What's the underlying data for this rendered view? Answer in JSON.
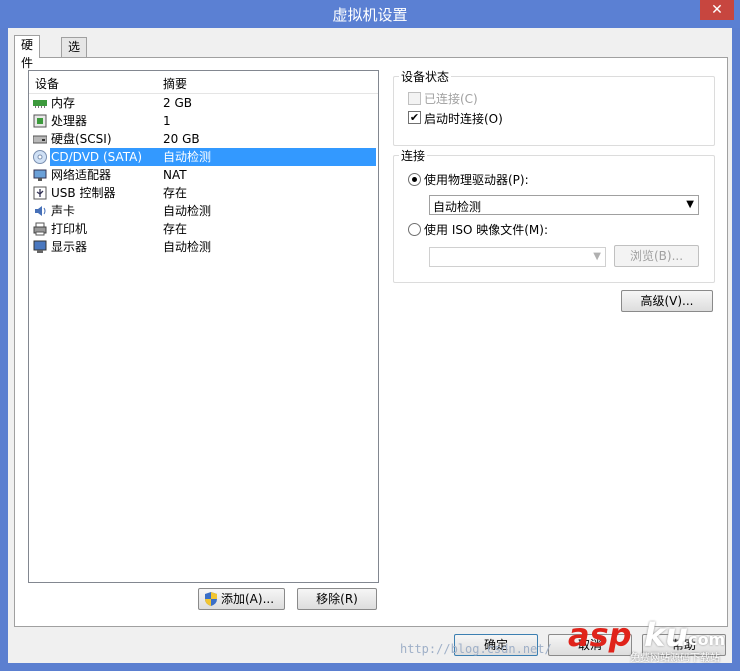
{
  "window": {
    "title": "虚拟机设置",
    "close_glyph": "✕"
  },
  "tabs": [
    {
      "label": "硬件",
      "active": true
    },
    {
      "label": "选项",
      "active": false
    }
  ],
  "device_list": {
    "columns": {
      "device": "设备",
      "summary": "摘要"
    },
    "rows": [
      {
        "name": "内存",
        "summary": "2 GB",
        "icon": "memory-icon"
      },
      {
        "name": "处理器",
        "summary": "1",
        "icon": "processor-icon"
      },
      {
        "name": "硬盘(SCSI)",
        "summary": "20 GB",
        "icon": "harddisk-icon"
      },
      {
        "name": "CD/DVD (SATA)",
        "summary": "自动检测",
        "icon": "cd-dvd-icon",
        "selected": true
      },
      {
        "name": "网络适配器",
        "summary": "NAT",
        "icon": "network-icon"
      },
      {
        "name": "USB 控制器",
        "summary": "存在",
        "icon": "usb-icon"
      },
      {
        "name": "声卡",
        "summary": "自动检测",
        "icon": "sound-icon"
      },
      {
        "name": "打印机",
        "summary": "存在",
        "icon": "printer-icon"
      },
      {
        "name": "显示器",
        "summary": "自动检测",
        "icon": "display-icon"
      }
    ],
    "add_button": "添加(A)...",
    "remove_button": "移除(R)"
  },
  "device_status": {
    "label": "设备状态",
    "connected": {
      "label": "已连接(C)",
      "checked": false,
      "enabled": false
    },
    "connect_at_power_on": {
      "label": "启动时连接(O)",
      "checked": true,
      "check_glyph": "✔"
    }
  },
  "connection": {
    "label": "连接",
    "use_physical": {
      "label": "使用物理驱动器(P):",
      "selected": true
    },
    "physical_drive_value": "自动检测",
    "use_iso": {
      "label": "使用 ISO 映像文件(M):",
      "selected": false
    },
    "iso_path_value": "",
    "browse_button": "浏览(B)..."
  },
  "advanced_button": "高级(V)...",
  "footer": {
    "ok_button": "确定",
    "cancel_button": "取消",
    "help_button": "帮助",
    "watermark": "http://blog.csdn.net/",
    "logo_asp": "asp",
    "logo_ku": "ku",
    "logo_com": ".com",
    "logo_tagline": "免费网站源码下载站"
  },
  "colors": {
    "selection": "#3399ff",
    "title_bar": "#5b80d3",
    "logo_red": "#e0231a"
  }
}
